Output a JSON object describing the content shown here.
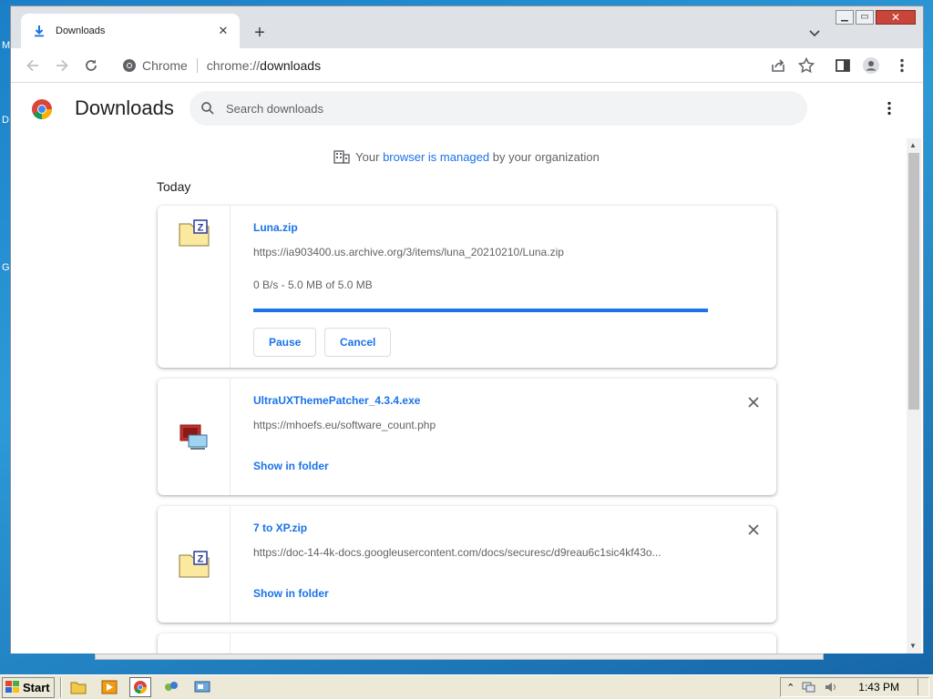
{
  "desktop": {
    "labels": [
      "M",
      "D",
      "G"
    ]
  },
  "window": {
    "tab": {
      "title": "Downloads",
      "favicon": "download-icon",
      "close_icon": "close-icon"
    },
    "new_tab_icon": "plus-icon",
    "tab_search_icon": "chevron-down-icon",
    "controls": {
      "minimize": "minimize-icon",
      "maximize": "maximize-icon",
      "close": "close-icon"
    }
  },
  "toolbar": {
    "back_icon": "arrow-left-icon",
    "forward_icon": "arrow-right-icon",
    "reload_icon": "reload-icon",
    "omnibox": {
      "site_label": "Chrome",
      "url_prefix": "chrome://",
      "url_host": "downloads"
    },
    "share_icon": "share-icon",
    "bookmark_icon": "star-icon",
    "side_panel_icon": "side-panel-icon",
    "profile_icon": "avatar-icon",
    "menu_icon": "kebab-menu-icon"
  },
  "downloads_page": {
    "title": "Downloads",
    "search_placeholder": "Search downloads",
    "managed_notice": {
      "prefix": "Your ",
      "link": "browser is managed",
      "suffix": " by your organization"
    },
    "date_header": "Today",
    "items": [
      {
        "filename": "Luna.zip",
        "url": "https://ia903400.us.archive.org/3/items/luna_20210210/Luna.zip",
        "status": "0 B/s - 5.0 MB of 5.0 MB",
        "progress": 1.0,
        "actions": [
          "Pause",
          "Cancel"
        ],
        "icon": "zip-file-icon"
      },
      {
        "filename": "UltraUXThemePatcher_4.3.4.exe",
        "url": "https://mhoefs.eu/software_count.php",
        "action_link": "Show in folder",
        "icon": "exe-file-icon"
      },
      {
        "filename": "7 to XP.zip",
        "url": "https://doc-14-4k-docs.googleusercontent.com/docs/securesc/d9reau6c1sic4kf43o...",
        "action_link": "Show in folder",
        "icon": "zip-file-icon"
      }
    ]
  },
  "taskbar": {
    "start_label": "Start",
    "clock": "1:43 PM",
    "colors": {
      "bar": "#ece9d8",
      "accent": "#1a73e8"
    }
  }
}
